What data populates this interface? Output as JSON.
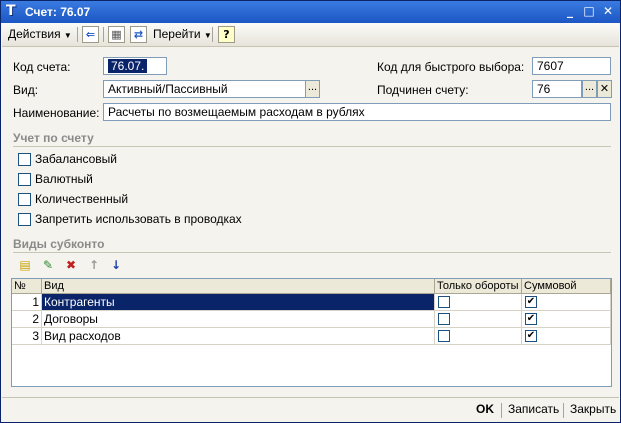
{
  "window": {
    "title": "Счет: 76.07",
    "app_icon_glyph": "Т"
  },
  "toolbar": {
    "actions_label": "Действия",
    "goto_label": "Перейти",
    "help_glyph": "?"
  },
  "form": {
    "code_label": "Код счета:",
    "code_value": "76.07.",
    "quick_code_label": "Код для быстрого выбора:",
    "quick_code_value": "7607",
    "type_label": "Вид:",
    "type_value": "Активный/Пассивный",
    "parent_label": "Подчинен счету:",
    "parent_value": "76",
    "name_label": "Наименование:",
    "name_value": "Расчеты по возмещаемым расходам в рублях"
  },
  "accounting": {
    "section_title": "Учет по счету",
    "options": [
      {
        "label": "Забалансовый",
        "checked": false
      },
      {
        "label": "Валютный",
        "checked": false
      },
      {
        "label": "Количественный",
        "checked": false
      },
      {
        "label": "Запретить использовать в проводках",
        "checked": false
      }
    ]
  },
  "subconto": {
    "section_title": "Виды субконто",
    "columns": {
      "num": "№",
      "kind": "Вид",
      "turnover_only": "Только обороты",
      "sum": "Суммовой"
    },
    "rows": [
      {
        "num": "1",
        "kind": "Контрагенты",
        "turnover_only": false,
        "sum": true
      },
      {
        "num": "2",
        "kind": "Договоры",
        "turnover_only": false,
        "sum": true
      },
      {
        "num": "3",
        "kind": "Вид расходов",
        "turnover_only": false,
        "sum": true
      }
    ]
  },
  "footer": {
    "ok_label": "OK",
    "save_label": "Записать",
    "close_label": "Закрыть"
  },
  "colors": {
    "titlebar": "#1c56c4",
    "selection": "#0a246a",
    "window_bg": "#f4f3ee"
  }
}
